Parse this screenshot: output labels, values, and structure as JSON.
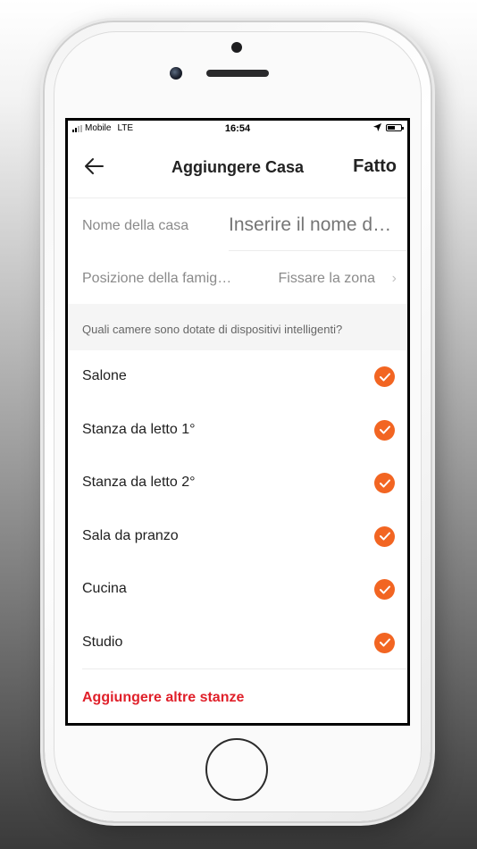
{
  "status_bar": {
    "carrier": "Mobile",
    "network": "LTE",
    "time": "16:54",
    "battery_level": 0.55
  },
  "nav": {
    "back_icon": "arrow-left-icon",
    "title": "Aggiungere Casa",
    "done_label": "Fatto"
  },
  "form": {
    "name_label": "Nome della casa",
    "name_placeholder": "Inserire il nome d…",
    "location_label": "Posizione della famig…",
    "location_value": "Fissare la zona",
    "location_chevron": "›"
  },
  "rooms_section": {
    "question": "Quali camere sono dotate di dispositivi intelligenti?",
    "rooms": [
      {
        "label": "Salone",
        "checked": true
      },
      {
        "label": "Stanza da letto 1°",
        "checked": true
      },
      {
        "label": "Stanza da letto 2°",
        "checked": true
      },
      {
        "label": "Sala da pranzo",
        "checked": true
      },
      {
        "label": "Cucina",
        "checked": true
      },
      {
        "label": "Studio",
        "checked": true
      }
    ],
    "add_more_label": "Aggiungere altre stanze"
  },
  "colors": {
    "accent": "#f26522",
    "link": "#e0202a"
  }
}
